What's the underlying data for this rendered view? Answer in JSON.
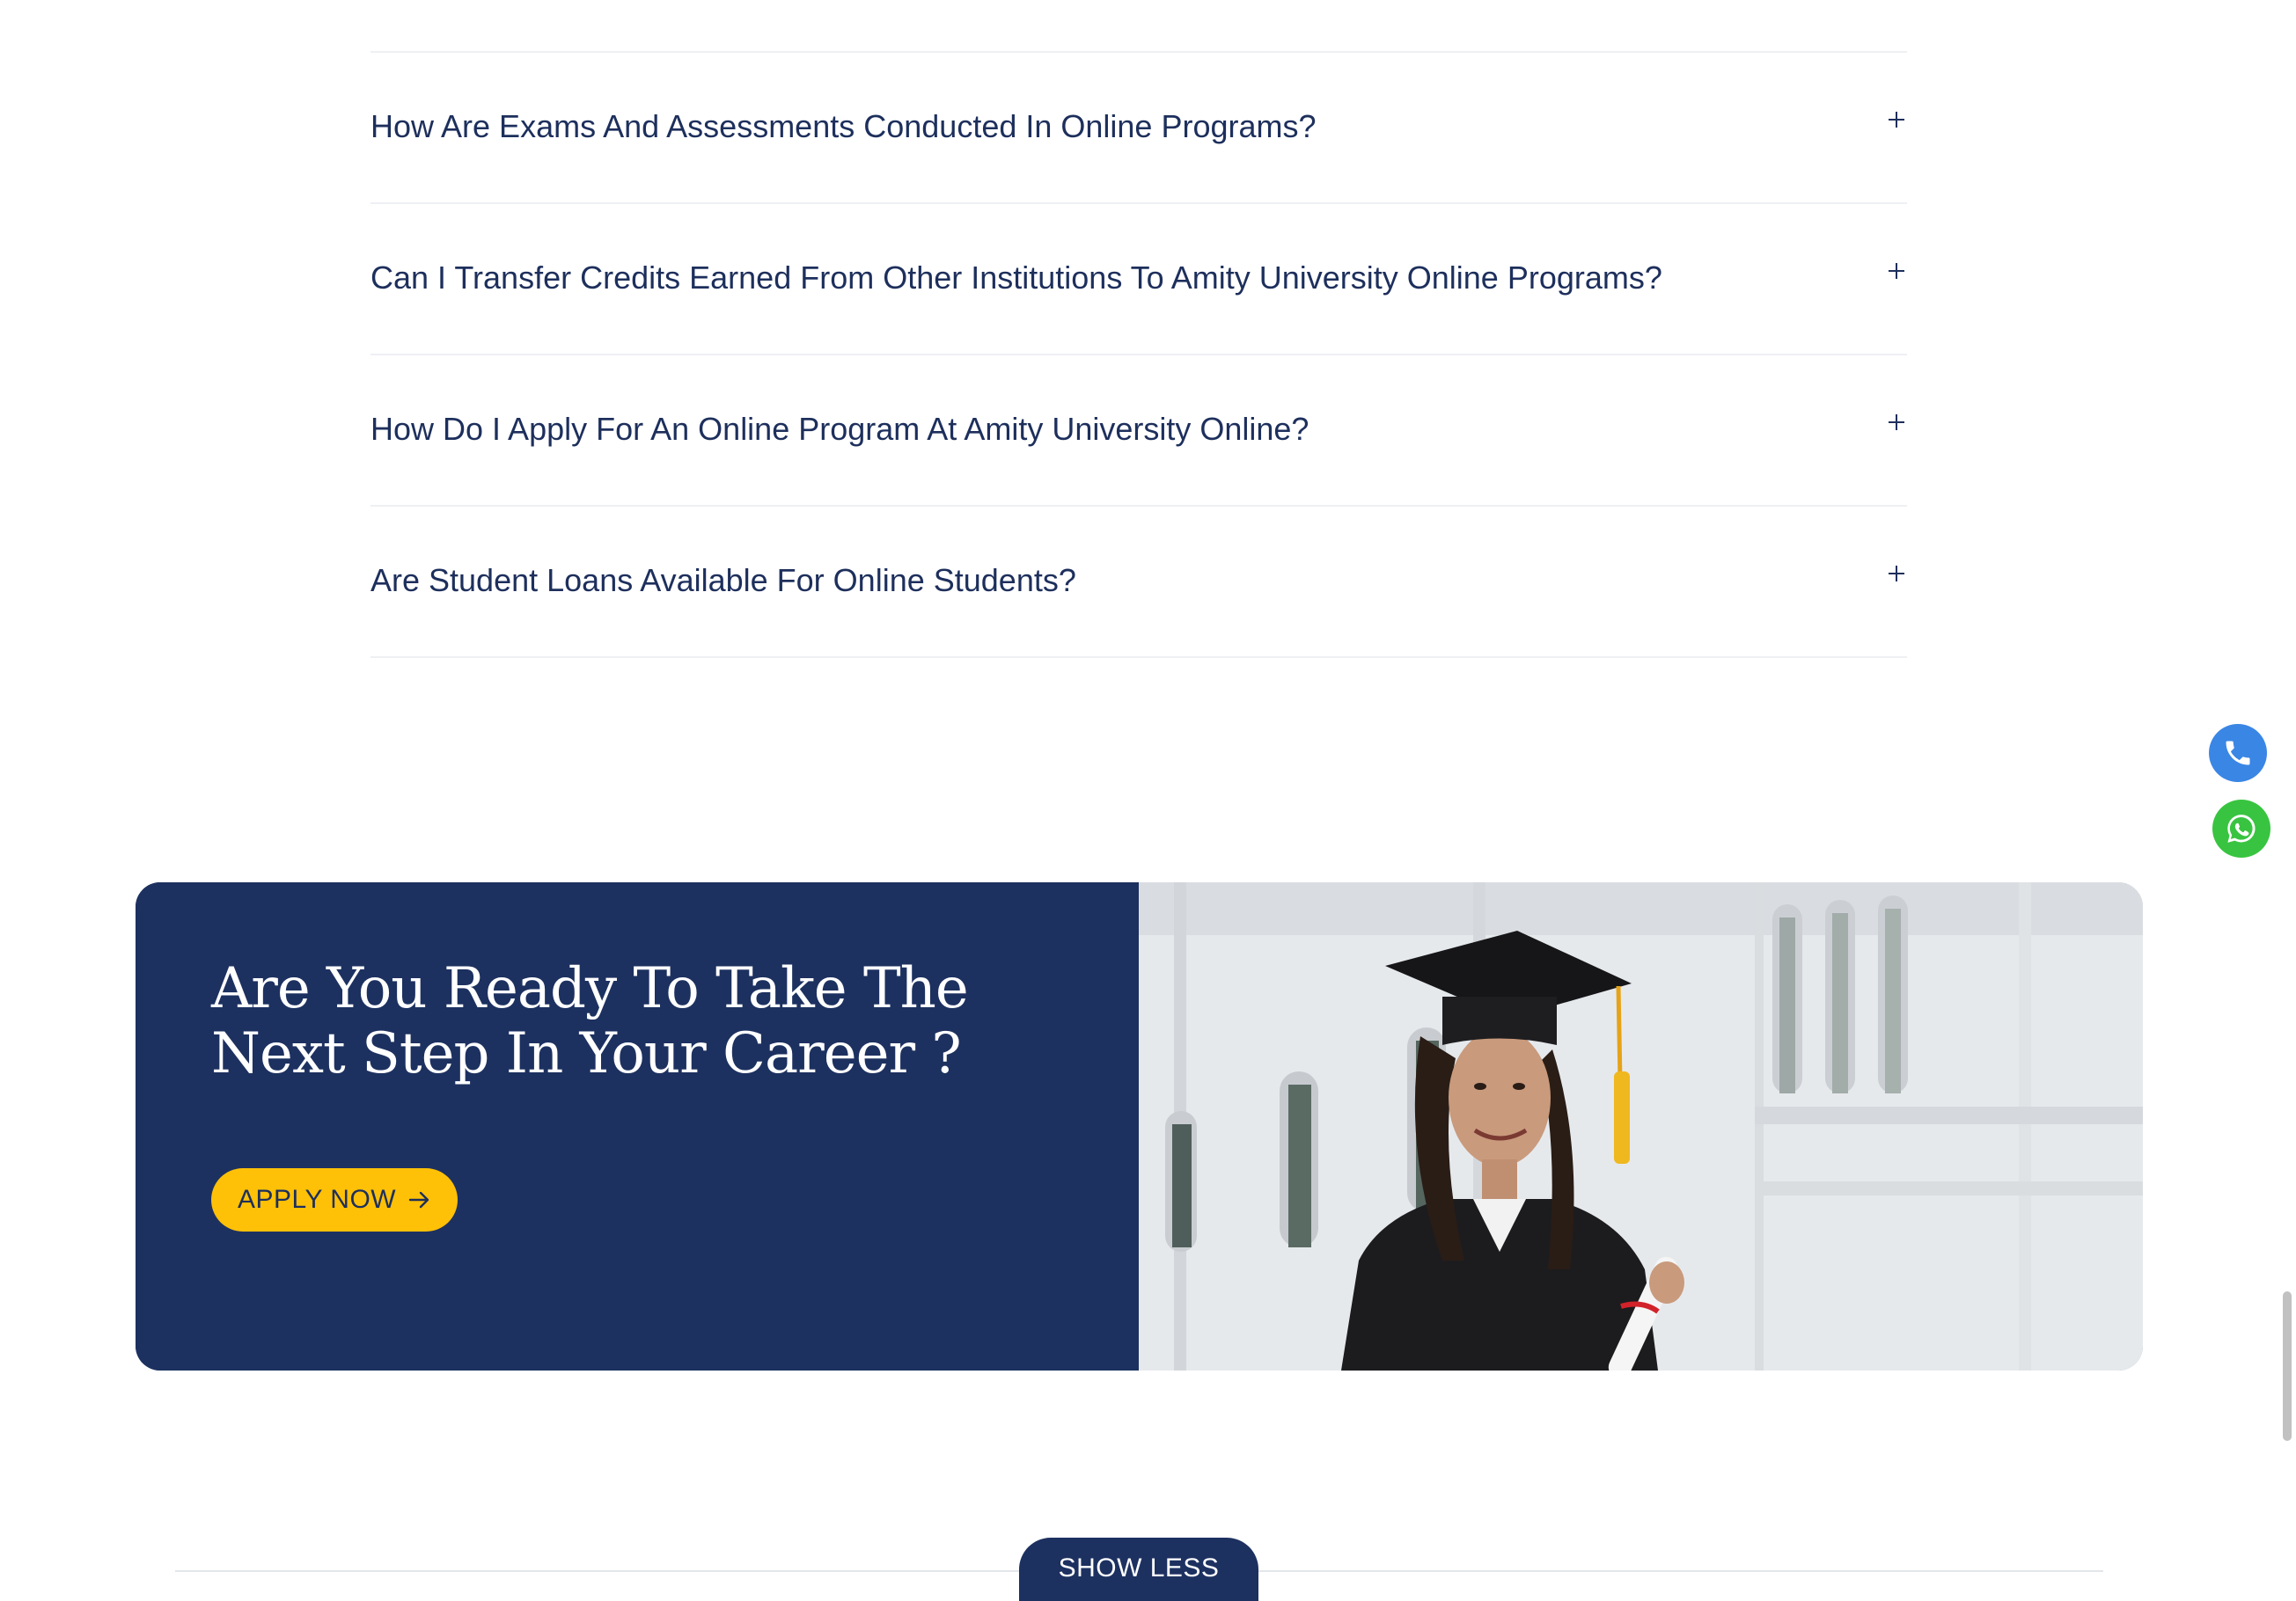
{
  "faq": {
    "items": [
      {
        "question": "How Are Exams And Assessments Conducted In Online Programs?"
      },
      {
        "question": "Can I Transfer Credits Earned From Other Institutions To Amity University Online Programs?"
      },
      {
        "question": "How Do I Apply For An Online Program At Amity University Online?"
      },
      {
        "question": "Are Student Loans Available For Online Students?"
      }
    ],
    "toggle_icon": "plus-icon"
  },
  "cta": {
    "heading": "Are You Ready To Take The Next Step In Your Career ?",
    "apply_label": "APPLY NOW",
    "apply_icon": "arrow-right-icon",
    "image": "graduate-photo"
  },
  "floating": {
    "phone_icon": "phone-icon",
    "whatsapp_icon": "whatsapp-icon"
  },
  "footer": {
    "show_less_label": "SHOW LESS"
  },
  "colors": {
    "navy": "#1d3160",
    "text": "#1d2f5c",
    "accent_yellow": "#ffc107",
    "phone_blue": "#3a86e5",
    "whatsapp_green": "#38c440"
  }
}
